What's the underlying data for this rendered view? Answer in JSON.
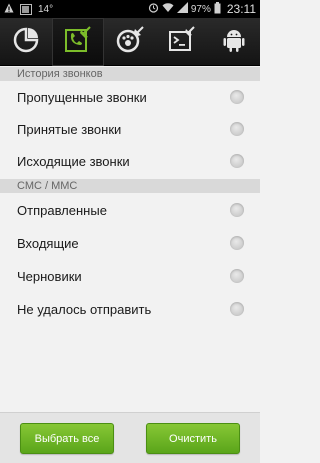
{
  "status_bar": {
    "notification_count": "14°",
    "battery_percent": "97%",
    "time": "23:11"
  },
  "toolbar": {
    "tabs": [
      {
        "name": "cache-cleaner-tab",
        "icon": "pie-broom-icon",
        "active": false
      },
      {
        "name": "history-tab",
        "icon": "phone-broom-icon",
        "active": true
      },
      {
        "name": "browser-tab",
        "icon": "paw-broom-icon",
        "active": false
      },
      {
        "name": "terminal-tab",
        "icon": "terminal-broom-icon",
        "active": false
      },
      {
        "name": "android-tab",
        "icon": "android-icon",
        "active": false
      }
    ],
    "active_color": "#7cbd2a"
  },
  "sections": [
    {
      "header": "История звонков",
      "items": [
        "Пропущенные звонки",
        "Принятые звонки",
        "Исходящие звонки"
      ]
    },
    {
      "header": "СМС / ММС",
      "items": [
        "Отправленные",
        "Входящие",
        "Черновики",
        "Не удалось отправить"
      ]
    }
  ],
  "buttons": {
    "select_all": "Выбрать все",
    "clear": "Очистить"
  }
}
